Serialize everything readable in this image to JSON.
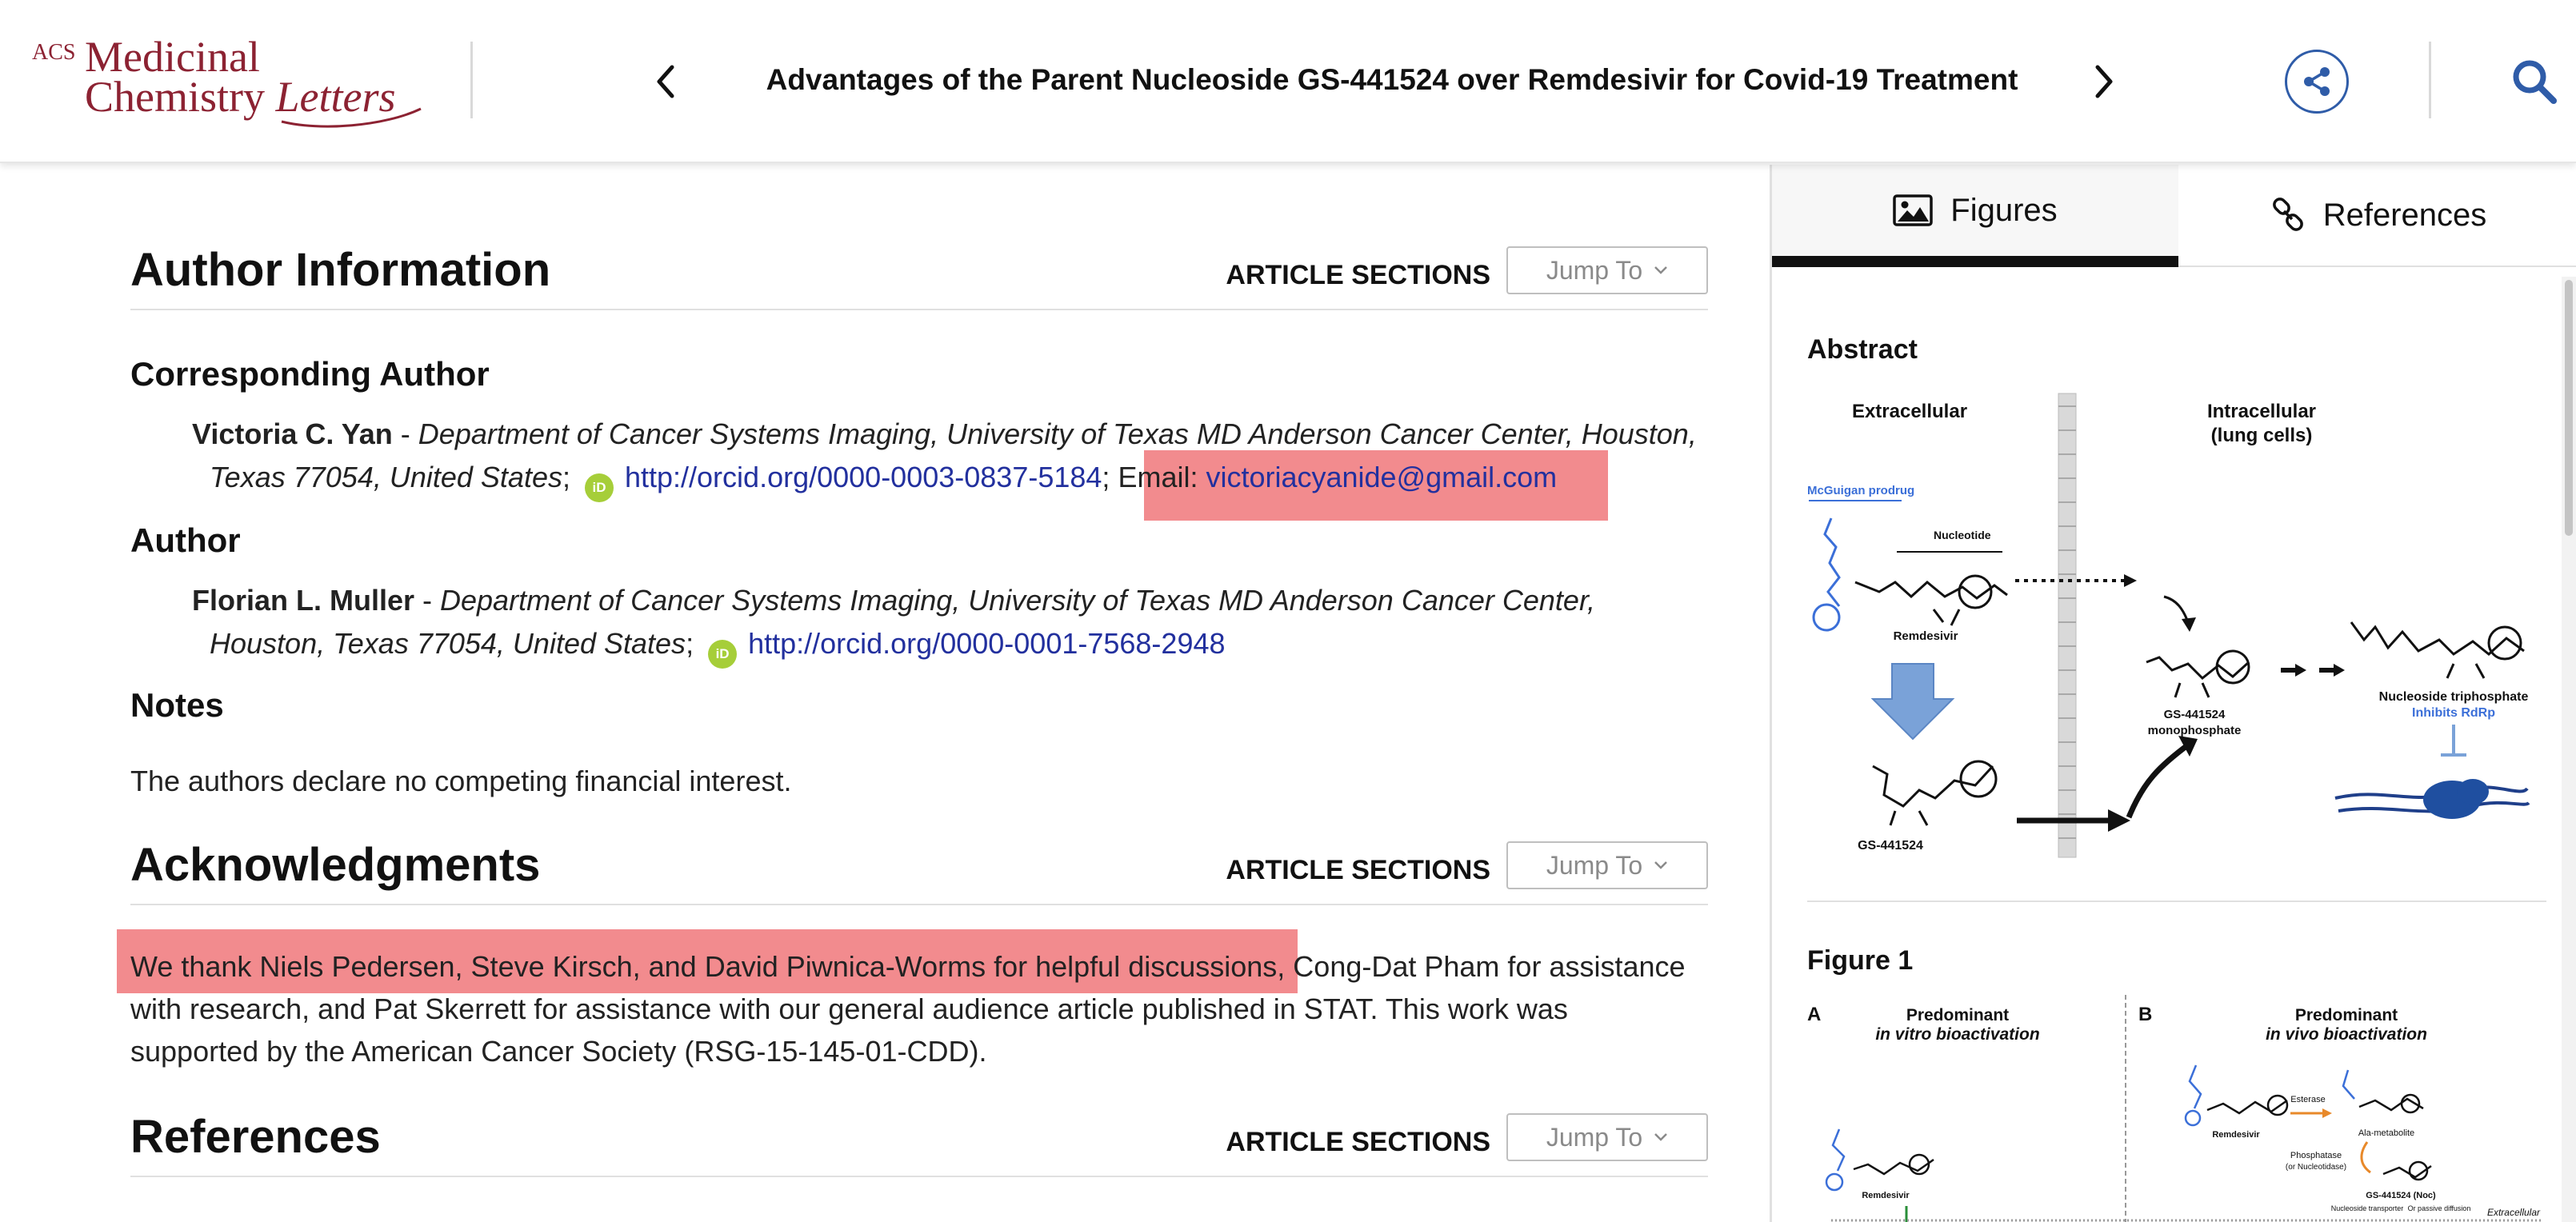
{
  "header": {
    "logo": {
      "acs": "ACS",
      "line1": "Medicinal",
      "line2a": "Chemistry ",
      "line2b": "Letters"
    },
    "prev_icon": "chevron-left-icon",
    "next_icon": "chevron-right-icon",
    "article_title": "Advantages of the Parent Nucleoside GS-441524 over Remdesivir for Covid-19 Treatment",
    "share_icon": "share-icon",
    "search_icon": "search-icon"
  },
  "sections": {
    "label": "ARTICLE SECTIONS",
    "jump_label": "Jump To",
    "author_info_title": "Author Information",
    "acknowledgments_title": "Acknowledgments",
    "references_title": "References"
  },
  "author_info": {
    "corresponding_heading": "Corresponding Author",
    "corresponding": {
      "name": "Victoria C. Yan",
      "sep": " - ",
      "dept_line1": "Department of Cancer Systems Imaging, University of Texas MD Anderson Cancer Center, Houston,",
      "dept_line2": "Texas 77054, United States",
      "orcid_url": "http://orcid.org/0000-0003-0837-5184",
      "email_label": "Email: ",
      "email": "victoriacyanide@gmail.com"
    },
    "author_heading": "Author",
    "author": {
      "name": "Florian L. Muller",
      "sep": " - ",
      "dept_line1": "Department of Cancer Systems Imaging, University of Texas MD Anderson Cancer Center,",
      "dept_line2": "Houston, Texas 77054, United States",
      "orcid_url": "http://orcid.org/0000-0001-7568-2948"
    },
    "orcid_badge": "iD",
    "notes_heading": "Notes",
    "notes_text": "The authors declare no competing financial interest."
  },
  "acknowledgments": {
    "highlighted": "We thank Niels Pedersen, Steve Kirsch, and David Piwnica-Worms for helpful discussions,",
    "rest_line1": " Cong-Dat Pham for assistance",
    "line2": "with research, and Pat Skerrett for assistance with our general audience article published in STAT. This work was",
    "line3": "supported by the American Cancer Society (RSG-15-145-01-CDD)."
  },
  "right_panel": {
    "tabs": [
      {
        "label": "Figures",
        "icon": "image-icon",
        "active": true
      },
      {
        "label": "References",
        "icon": "link-icon",
        "active": false
      }
    ],
    "abstract_label": "Abstract",
    "abstract_fig": {
      "extracellular": "Extracellular",
      "intracellular_1": "Intracellular",
      "intracellular_2": "(lung cells)",
      "mcguigan": "McGuigan prodrug",
      "nucleotide": "Nucleotide",
      "remdesivir": "Remdesivir",
      "gs": "GS-441524",
      "gs_mono_1": "GS-441524",
      "gs_mono_2": "monophosphate",
      "ntp": "Nucleoside triphosphate",
      "inhibits": "Inhibits RdRp"
    },
    "figure1_label": "Figure 1",
    "figure1": {
      "panel_a": "A",
      "panel_b": "B",
      "a_title_1": "Predominant",
      "a_title_2": "in vitro bioactivation",
      "b_title_1": "Predominant",
      "b_title_2": "in vivo bioactivation",
      "esterase": "Esterase",
      "ala": "Ala-metabolite",
      "phosphatase_1": "Phosphatase",
      "phosphatase_2": "(or Nucleotidase)",
      "remdesivir": "Remdesivir",
      "gs_noc": "GS-441524 (Noc)",
      "transporter": "Nucleoside transporter",
      "passive": "Or passive diffusion",
      "extracellular": "Extracellular"
    }
  },
  "colors": {
    "brand": "#8c2232",
    "link": "#22309e",
    "highlight": "#f28b8e",
    "icon_blue": "#2f5ca8",
    "orcid": "#a6ce39",
    "prodrug_blue": "#3b6fd8"
  }
}
